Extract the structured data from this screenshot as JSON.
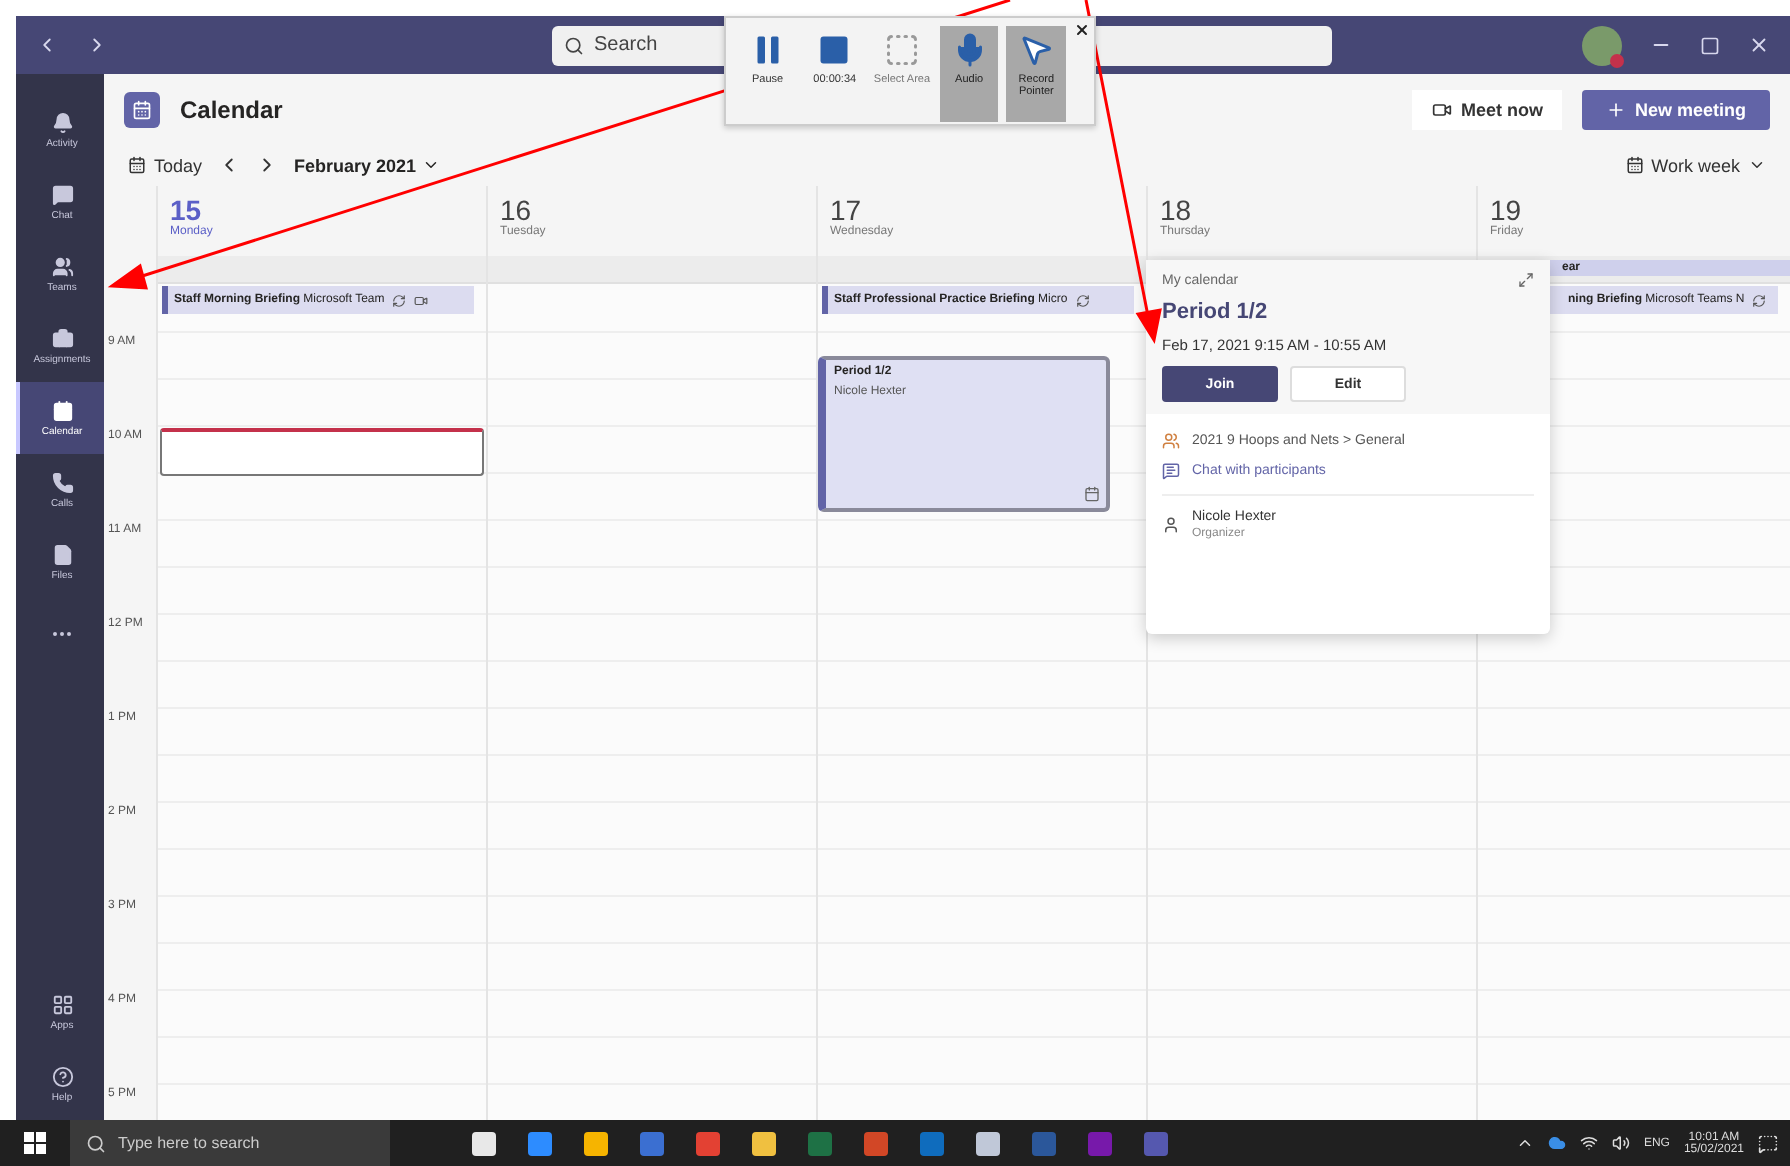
{
  "title_bar": {
    "search": {
      "placeholder": "Search"
    }
  },
  "recorder": {
    "items": [
      {
        "kind": "pause",
        "label": "Pause",
        "on": false,
        "disabled": false
      },
      {
        "kind": "stop",
        "label": "00:00:34",
        "on": false,
        "disabled": false
      },
      {
        "kind": "area",
        "label": "Select Area",
        "on": false,
        "disabled": true
      },
      {
        "kind": "audio",
        "label": "Audio",
        "on": true,
        "disabled": false
      },
      {
        "kind": "pointer",
        "label": "Record Pointer",
        "on": true,
        "disabled": false
      }
    ]
  },
  "sidebar": {
    "items": [
      {
        "kind": "activity",
        "label": "Activity",
        "selected": false
      },
      {
        "kind": "chat",
        "label": "Chat",
        "selected": false
      },
      {
        "kind": "teams",
        "label": "Teams",
        "selected": false
      },
      {
        "kind": "assignments",
        "label": "Assignments",
        "selected": false
      },
      {
        "kind": "calendar",
        "label": "Calendar",
        "selected": true
      },
      {
        "kind": "calls",
        "label": "Calls",
        "selected": false
      },
      {
        "kind": "files",
        "label": "Files",
        "selected": false
      }
    ],
    "bottom": [
      {
        "kind": "apps",
        "label": "Apps",
        "selected": false
      },
      {
        "kind": "help",
        "label": "Help",
        "selected": false
      }
    ]
  },
  "header": {
    "title": "Calendar",
    "meet_now": "Meet now",
    "new_meeting": "New meeting"
  },
  "toolbar": {
    "today": "Today",
    "month": "February 2021",
    "view": "Work week"
  },
  "hours": [
    "9 AM",
    "10 AM",
    "11 AM",
    "12 PM",
    "1 PM",
    "2 PM",
    "3 PM",
    "4 PM",
    "5 PM"
  ],
  "days": [
    {
      "date": "15",
      "weekday": "Monday",
      "selected": true,
      "events": [
        {
          "kind": "banner",
          "title": "Staff Morning Briefing",
          "detail": "Microsoft Team",
          "recurring": true,
          "online": true
        },
        {
          "kind": "slot"
        }
      ]
    },
    {
      "date": "16",
      "weekday": "Tuesday",
      "selected": false
    },
    {
      "date": "17",
      "weekday": "Wednesday",
      "selected": false,
      "events": [
        {
          "kind": "banner",
          "title": "Staff Professional Practice Briefing",
          "detail": "Micro",
          "recurring": true,
          "online": false
        },
        {
          "kind": "block",
          "title": "Period 1/2",
          "organizer": "Nicole Hexter",
          "selected": true
        }
      ]
    },
    {
      "date": "18",
      "weekday": "Thursday",
      "selected": false
    },
    {
      "date": "19",
      "weekday": "Friday",
      "selected": false,
      "events": [
        {
          "kind": "strip",
          "title": "ear"
        },
        {
          "kind": "banner",
          "title": "ning Briefing",
          "detail": "Microsoft Teams N",
          "recurring": true,
          "online": false
        }
      ]
    }
  ],
  "popup": {
    "calendar": "My calendar",
    "title": "Period 1/2",
    "time": "Feb 17, 2021 9:15 AM - 10:55 AM",
    "join": "Join",
    "edit": "Edit",
    "channel": "2021 9 Hoops and Nets > General",
    "chat": "Chat with participants",
    "organizer": "Nicole Hexter",
    "role": "Organizer"
  },
  "taskbar": {
    "search": {
      "placeholder": "Type here to search"
    },
    "language": "ENG",
    "time": "10:01 AM",
    "date": "15/02/2021"
  }
}
